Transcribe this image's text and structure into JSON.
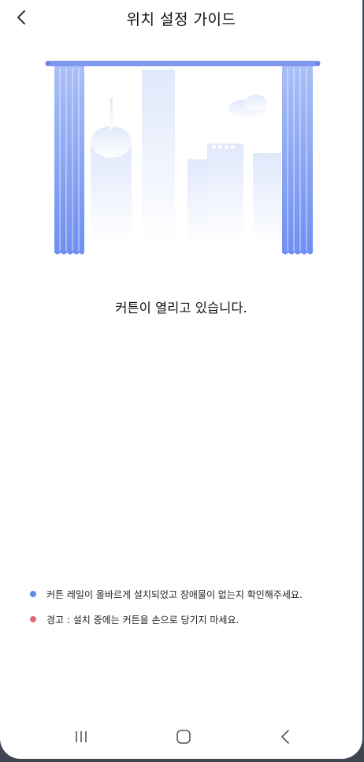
{
  "header": {
    "title": "위치 설정 가이드",
    "back_icon": "chevron-left-icon"
  },
  "status": {
    "message": "커튼이 열리고 있습니다."
  },
  "notes": [
    {
      "text": "커튼 레일이 올바르게 설치되었고 장애물이 없는지 확인해주세요.",
      "color": "#5b8def"
    },
    {
      "text": "경고 : 설치 중에는 커튼을 손으로 당기지 마세요.",
      "color": "#e06a7a"
    }
  ],
  "colors": {
    "curtain": "#7b9cf5",
    "rail": "#7e93ee",
    "city": "#e4ebfb"
  },
  "navbar": {
    "recents_icon": "recent-apps-icon",
    "home_icon": "home-icon",
    "back_icon": "back-icon"
  }
}
